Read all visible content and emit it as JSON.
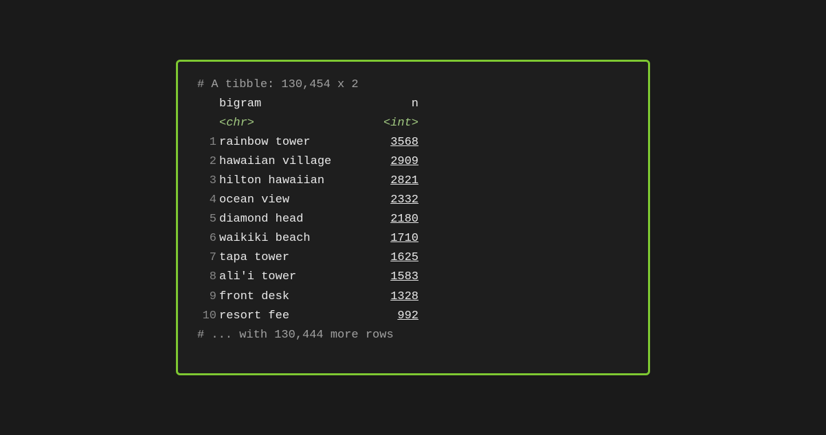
{
  "terminal": {
    "header": "# A tibble: 130,454 x 2",
    "col_bigram": "bigram",
    "col_n": "n",
    "type_bigram": "<chr>",
    "type_n": "<int>",
    "rows": [
      {
        "num": "1",
        "bigram": "rainbow tower",
        "n": "3568"
      },
      {
        "num": "2",
        "bigram": "hawaiian village",
        "n": "2909"
      },
      {
        "num": "3",
        "bigram": "hilton hawaiian",
        "n": "2821"
      },
      {
        "num": "4",
        "bigram": "ocean view",
        "n": "2332"
      },
      {
        "num": "5",
        "bigram": "diamond head",
        "n": "2180"
      },
      {
        "num": "6",
        "bigram": "waikiki beach",
        "n": "1710"
      },
      {
        "num": "7",
        "bigram": "tapa tower",
        "n": "1625"
      },
      {
        "num": "8",
        "bigram": "ali'i tower",
        "n": "1583"
      },
      {
        "num": "9",
        "bigram": "front desk",
        "n": "1328"
      },
      {
        "num": "10",
        "bigram": "resort fee",
        "n": "992"
      }
    ],
    "footer": "# ... with 130,444 more rows"
  }
}
